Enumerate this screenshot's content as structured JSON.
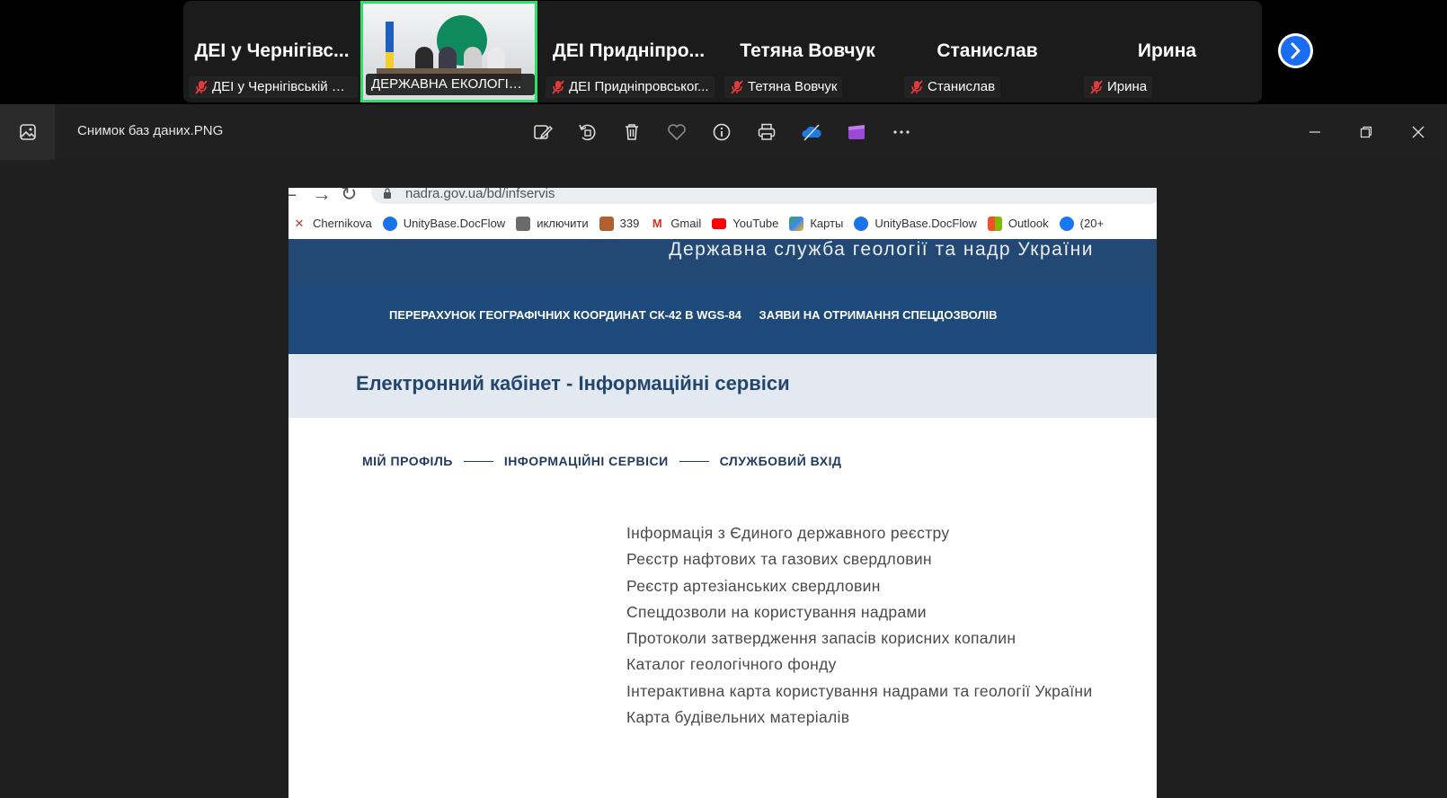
{
  "meeting": {
    "participants": [
      {
        "name": "ДЕІ у Чернігівс...",
        "label": "ДЕІ у Чернігівській об..."
      },
      {
        "name": "",
        "label": "ДЕРЖАВНА ЕКОЛОГІЧНА..."
      },
      {
        "name": "ДЕІ Придніпро...",
        "label": "ДЕІ Придніпровськог..."
      },
      {
        "name": "Тетяна Вовчук",
        "label": "Тетяна Вовчук"
      },
      {
        "name": "Станислав",
        "label": "Станислав"
      },
      {
        "name": "Ирина",
        "label": "Ирина"
      }
    ],
    "next_icon": "chevron-right-icon"
  },
  "viewer": {
    "file_name": "Снимок баз даних.PNG",
    "toolbar_icons": [
      "edit-image-icon",
      "rotate-icon",
      "delete-icon",
      "favorite-icon",
      "info-icon",
      "print-icon",
      "onedrive-icon",
      "clipchamp-icon",
      "more-icon"
    ],
    "window_icons": [
      "minimize-icon",
      "restore-icon",
      "close-icon"
    ]
  },
  "screenshot": {
    "browser": {
      "url": "nadra.gov.ua/bd/infservis",
      "bookmarks": [
        "Chernikova",
        "UnityBase.DocFlow",
        "иключити",
        "339",
        "Gmail",
        "YouTube",
        "Карты",
        "UnityBase.DocFlow",
        "Outlook",
        "(20+"
      ]
    },
    "site": {
      "agency": "Державна служба геології та надр України",
      "nav": [
        "ПЕРЕРАХУНОК ГЕОГРАФІЧНИХ КООРДИНАТ СК-42 В WGS-84",
        "ЗАЯВИ НА ОТРИМАННЯ СПЕЦДОЗВОЛІВ"
      ],
      "cabinet_title": "Електронний кабінет - Інформаційні сервіси",
      "breadcrumbs": [
        "МІЙ ПРОФІЛЬ",
        "ІНФОРМАЦІЙНІ СЕРВІСИ",
        "СЛУЖБОВИЙ ВХІД"
      ],
      "services": [
        "Інформація з Єдиного державного реєстру",
        "Реєстр нафтових та газових свердловин",
        "Реєстр артезіанських свердловин",
        "Спецдозволи на користування надрами",
        "Протоколи затвердження запасів корисних копалин",
        "Каталог геологічного фонду",
        "Інтерактивна карта користування надрами та геології України",
        "Карта будівельних матеріалів"
      ]
    }
  },
  "colors": {
    "header_blue": "#1d4a7a",
    "active_speaker": "#2ee06a",
    "zoom_blue": "#1a6cf0",
    "mute_red": "#e23b3b"
  }
}
